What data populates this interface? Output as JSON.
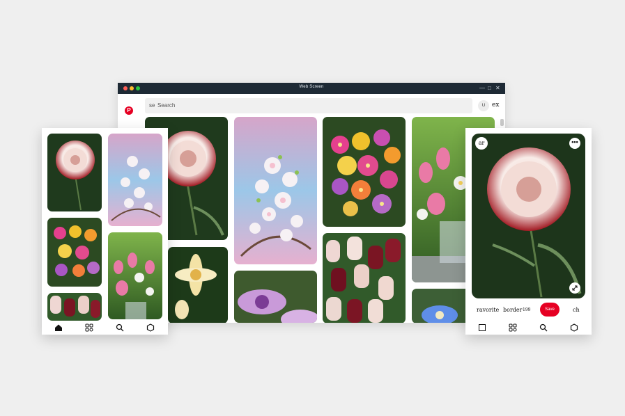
{
  "window": {
    "title": "Web Screen",
    "search": {
      "prefix": "se",
      "placeholder": "Search"
    },
    "account_initial": "U",
    "account_label": "ex",
    "logo_letter": "P",
    "controls": [
      "—",
      "□",
      "✕"
    ]
  },
  "images": {
    "carnation": "carnation-image",
    "cherry": "cherry-blossom-image",
    "primrose": "primrose-image",
    "tulips_bouquet": "tulip-bouquet-image",
    "lily": "lily-image",
    "striped_tulips": "striped-tulips-image",
    "purple_flower": "purple-flower-image",
    "blue_flower": "blue-flower-image"
  },
  "left_phone": {
    "nav": [
      "home-icon",
      "explore-icon",
      "search-icon",
      "profile-icon"
    ]
  },
  "right_phone": {
    "badge": "ar",
    "menu": "•••",
    "favorite_label": "ravorite",
    "border_label": "border",
    "count": "199",
    "save_label": "Save",
    "trailing_label": "ch"
  },
  "colors": {
    "brand": "#e60023",
    "titlebar": "#1e2a35"
  }
}
